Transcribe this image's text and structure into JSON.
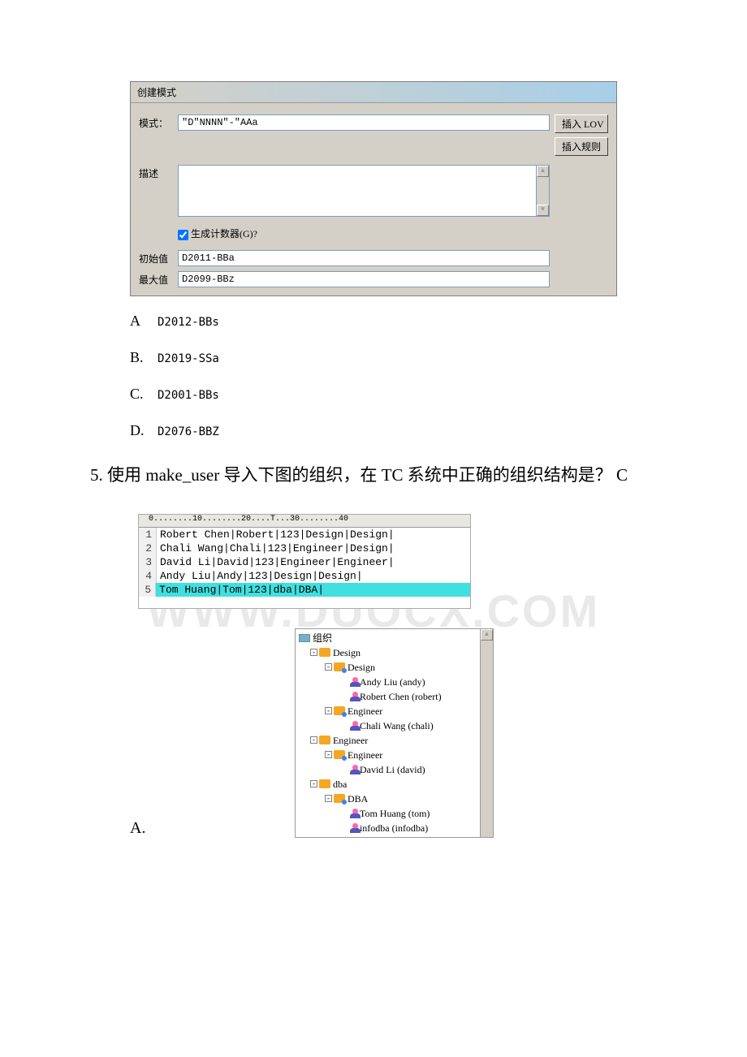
{
  "dialog": {
    "title": "创建模式",
    "pattern_label": "模式：",
    "pattern_value": "\"D\"NNNN\"-\"AAa",
    "insert_lov_btn": "插入 LOV",
    "insert_rule_btn": "插入规则",
    "desc_label": "描述",
    "counter_checkbox_label": "生成计数器(G)?",
    "counter_checked": true,
    "init_label": "初始值",
    "init_value": "D2011-BBa",
    "max_label": "最大值",
    "max_value": "D2099-BBz"
  },
  "options4": {
    "A": "D2012-BBs",
    "B": "D2019-SSa",
    "C": "D2001-BBs",
    "D": "D2076-BBZ"
  },
  "question5": {
    "number": "5.",
    "text_before": "使用 make_user 导入下图的组织，在 TC 系统中正确的组织结构是？",
    "answer": "C"
  },
  "editor": {
    "ruler": "0........10........20....T...30........40",
    "lines": [
      "Robert Chen|Robert|123|Design|Design|",
      "Chali Wang|Chali|123|Engineer|Design|",
      "David Li|David|123|Engineer|Engineer|",
      "Andy Liu|Andy|123|Design|Design|",
      "Tom Huang|Tom|123|dba|DBA|"
    ],
    "highlight_index": 4
  },
  "tree": {
    "root": "组织",
    "nodes": [
      {
        "level": 1,
        "toggle": "-",
        "icon": "group",
        "label": "Design"
      },
      {
        "level": 2,
        "toggle": "-",
        "icon": "group-blue",
        "label": "Design"
      },
      {
        "level": 3,
        "toggle": "",
        "icon": "user",
        "label": "Andy Liu (andy)"
      },
      {
        "level": 3,
        "toggle": "",
        "icon": "user",
        "label": "Robert Chen (robert)"
      },
      {
        "level": 2,
        "toggle": "-",
        "icon": "group-blue",
        "label": "Engineer"
      },
      {
        "level": 3,
        "toggle": "",
        "icon": "user",
        "label": "Chali Wang (chali)"
      },
      {
        "level": 1,
        "toggle": "-",
        "icon": "group",
        "label": "Engineer"
      },
      {
        "level": 2,
        "toggle": "-",
        "icon": "group-blue",
        "label": "Engineer"
      },
      {
        "level": 3,
        "toggle": "",
        "icon": "user",
        "label": "David Li (david)"
      },
      {
        "level": 1,
        "toggle": "-",
        "icon": "group",
        "label": "dba"
      },
      {
        "level": 2,
        "toggle": "-",
        "icon": "group-blue",
        "label": "DBA"
      },
      {
        "level": 3,
        "toggle": "",
        "icon": "user",
        "label": "Tom Huang (tom)"
      },
      {
        "level": 3,
        "toggle": "",
        "icon": "user",
        "label": "infodba (infodba)"
      }
    ]
  },
  "answer_marker": "A."
}
